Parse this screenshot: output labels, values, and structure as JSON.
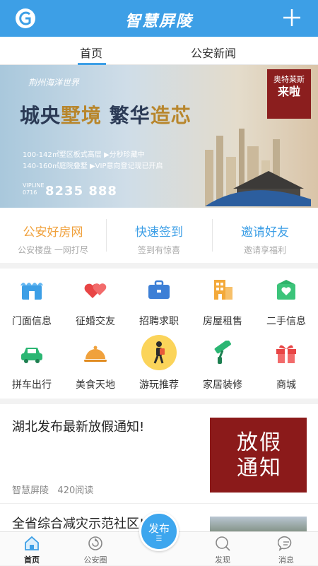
{
  "app": {
    "title": "智慧屏陵"
  },
  "tabs": [
    {
      "label": "首页"
    },
    {
      "label": "公安新闻"
    }
  ],
  "banner": {
    "brand": "荆州海洋世界",
    "slogan_a": "城央",
    "slogan_b": "墅境",
    "slogan_c": "繁华",
    "slogan_d": "造芯",
    "line1": "100-142㎡墅区板式高层 ▶分秒珍藏中",
    "line2": "140-160㎡庭院叠墅 ▶VIP意向登记现已开启",
    "vip_label": "VIPLINE",
    "vip_code": "0716",
    "phone": "8235 888",
    "stamp_small": "奥特莱斯",
    "stamp_big": "来啦"
  },
  "quick_links": [
    {
      "title": "公安好房网",
      "subtitle": "公安楼盘 一网打尽",
      "color": "#f0a13c"
    },
    {
      "title": "快速签到",
      "subtitle": "签到有惊喜",
      "color": "#3d9fe6"
    },
    {
      "title": "邀请好友",
      "subtitle": "邀请享福利",
      "color": "#3d9fe6"
    }
  ],
  "services": [
    {
      "label": "门面信息",
      "icon": "storefront-icon"
    },
    {
      "label": "征婚交友",
      "icon": "hearts-icon"
    },
    {
      "label": "招聘求职",
      "icon": "briefcase-icon"
    },
    {
      "label": "房屋租售",
      "icon": "building-icon"
    },
    {
      "label": "二手信息",
      "icon": "shop-bag-icon"
    },
    {
      "label": "拼车出行",
      "icon": "car-icon"
    },
    {
      "label": "美食天地",
      "icon": "food-cloche-icon"
    },
    {
      "label": "游玩推荐",
      "icon": "hiker-icon"
    },
    {
      "label": "家居装修",
      "icon": "paint-roller-icon"
    },
    {
      "label": "商城",
      "icon": "gift-icon"
    }
  ],
  "news": [
    {
      "headline": "湖北发布最新放假通知!",
      "source": "智慧屏陵",
      "reads": "420阅读",
      "thumb_text_1": "放假",
      "thumb_text_2": "通知"
    },
    {
      "headline": "全省综合减灾示范社区! 公安"
    }
  ],
  "bottom_nav": [
    {
      "label": "首页",
      "icon": "home-icon",
      "active": true
    },
    {
      "label": "公安圈",
      "icon": "circle-refresh-icon"
    },
    {
      "label": "发布",
      "icon": "publish-icon"
    },
    {
      "label": "发现",
      "icon": "discover-icon"
    },
    {
      "label": "消息",
      "icon": "message-icon"
    }
  ]
}
